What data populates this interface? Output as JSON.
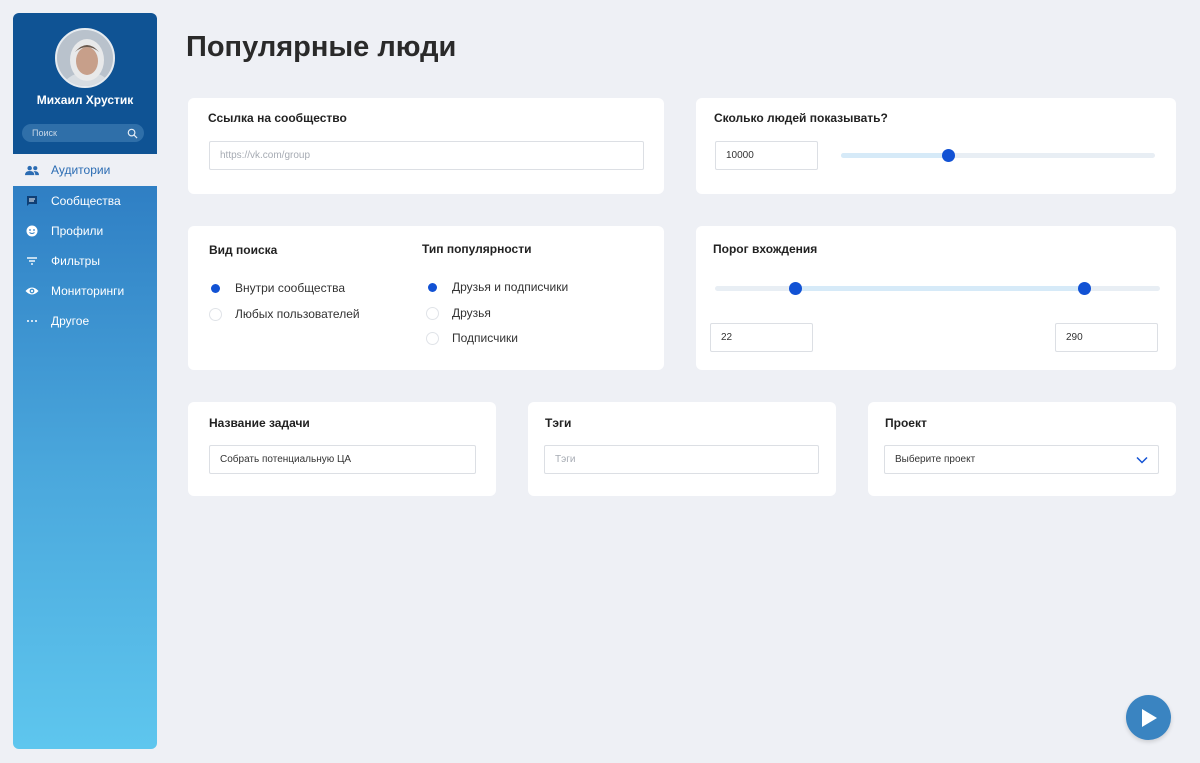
{
  "profile": {
    "name": "Михаил Хрустик"
  },
  "search": {
    "placeholder": "Поиск"
  },
  "sidebar": {
    "active": {
      "label": "Аудитории",
      "icon": "people-icon"
    },
    "items": [
      {
        "label": "Сообщества",
        "icon": "chat-icon"
      },
      {
        "label": "Профили",
        "icon": "face-icon"
      },
      {
        "label": "Фильтры",
        "icon": "filter-icon"
      },
      {
        "label": "Мониторинги",
        "icon": "eye-icon"
      },
      {
        "label": "Другое",
        "icon": "more-icon"
      }
    ]
  },
  "page": {
    "title": "Популярные люди"
  },
  "community_link": {
    "title": "Ссылка на сообщество",
    "placeholder": "https://vk.com/group"
  },
  "people_count": {
    "title": "Сколько людей показывать?",
    "value": "10000",
    "slider_fraction": 0.34
  },
  "search_type": {
    "title": "Вид поиска",
    "options": [
      {
        "label": "Внутри сообщества",
        "checked": true
      },
      {
        "label": "Любых пользователей",
        "checked": false
      }
    ]
  },
  "popularity_type": {
    "title": "Тип популярности",
    "options": [
      {
        "label": "Друзья и подписчики",
        "checked": true
      },
      {
        "label": "Друзья",
        "checked": false
      },
      {
        "label": "Подписчики",
        "checked": false
      }
    ]
  },
  "threshold": {
    "title": "Порог вхождения",
    "min_value": "22",
    "max_value": "290",
    "min_fraction": 0.18,
    "max_fraction": 0.83
  },
  "task_name": {
    "title": "Название задачи",
    "value": "Собрать потенциальную ЦА"
  },
  "tags": {
    "title": "Тэги",
    "placeholder": "Тэги"
  },
  "project": {
    "title": "Проект",
    "selected": "Выберите проект"
  },
  "colors": {
    "accent": "#1252d4",
    "sidebar_top": "#0f5394",
    "play": "#3a84c1"
  }
}
